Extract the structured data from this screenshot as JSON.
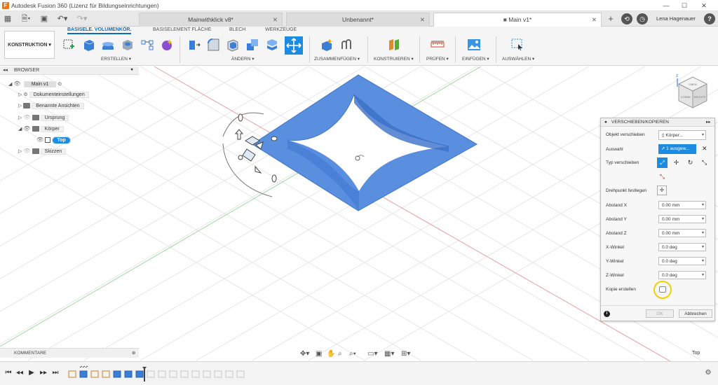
{
  "app": {
    "title": "Autodesk Fusion 360 (Lizenz für Bildungseinrichtungen)"
  },
  "tabs": [
    {
      "label": "Mainwithklick v8*"
    },
    {
      "label": "Unbenannt*"
    },
    {
      "label": "Main v1*"
    }
  ],
  "user": {
    "name": "Lena Hagenauer"
  },
  "workspace": {
    "label": "KONSTRUKTION"
  },
  "ribbon": {
    "tabs": [
      "BASISELE. VOLUMENKÖR.",
      "BASISELEMENT FLÄCHE",
      "BLECH",
      "WERKZEUGE"
    ],
    "groups": [
      "ERSTELLEN",
      "ÄNDERN",
      "ZUSAMMENFÜGEN",
      "KONSTRUIEREN",
      "PRÜFEN",
      "EINFÜGEN",
      "AUSWÄHLEN"
    ]
  },
  "browser": {
    "title": "BROWSER",
    "root": "Main v1",
    "items": [
      "Dokumenteinstellungen",
      "Benannte Ansichten",
      "Ursprung",
      "Körper",
      "Top",
      "Skizzen"
    ]
  },
  "comments": {
    "label": "KOMMENTARE"
  },
  "move_panel": {
    "title": "VERSCHIEBEN/KOPIEREN",
    "object_label": "Objekt verschieben",
    "object_value": "Körper...",
    "selection_label": "Auswahl",
    "selection_value": "1 ausgew...",
    "type_label": "Typ verschieben",
    "pivot_label": "Drehpunkt festlegen",
    "fields": [
      {
        "label": "Abstand X",
        "value": "0.00 mm"
      },
      {
        "label": "Abstand Y",
        "value": "0.00 mm"
      },
      {
        "label": "Abstand Z",
        "value": "0.00 mm"
      },
      {
        "label": "X-Winkel",
        "value": "0.0 deg"
      },
      {
        "label": "Y-Winkel",
        "value": "0.0 deg"
      },
      {
        "label": "Z-Winkel",
        "value": "0.0 deg"
      }
    ],
    "copy_label": "Kopie erstellen",
    "copy_checked": false,
    "ok_label": "OK",
    "cancel_label": "Abbrechen"
  },
  "viewcube": {
    "top": "OBEN",
    "front": "VORNE",
    "right": "RECHTS",
    "axis_z": "Z"
  },
  "view_label": "Top",
  "colors": {
    "accent": "#0a6ebd",
    "body": "#5a8fe0",
    "highlight": "#f0d000"
  }
}
